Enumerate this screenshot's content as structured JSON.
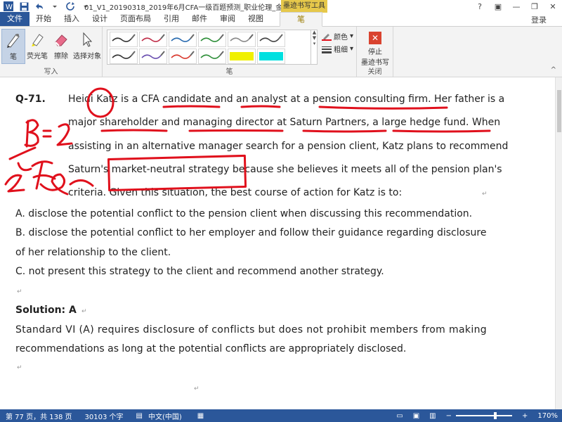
{
  "title_bar": {
    "doc_title": "01_V1_20190318_2019年6月CFA一级百题预测_职业伦理_金程...",
    "context_tab_title": "墨迹书写工具",
    "signin": "登录"
  },
  "tabs": [
    {
      "label": "文件"
    },
    {
      "label": "开始"
    },
    {
      "label": "插入"
    },
    {
      "label": "设计"
    },
    {
      "label": "页面布局"
    },
    {
      "label": "引用"
    },
    {
      "label": "邮件"
    },
    {
      "label": "审阅"
    },
    {
      "label": "视图"
    },
    {
      "label": "笔"
    }
  ],
  "ribbon": {
    "write_group": {
      "label": "写入",
      "tools": [
        {
          "label": "笔"
        },
        {
          "label": "荧光笔"
        },
        {
          "label": "擦除"
        },
        {
          "label": "选择对象"
        }
      ]
    },
    "pen_group": {
      "label": "笔",
      "color_label": "颜色",
      "weight_label": "粗细",
      "swatch_colors": [
        "#333333",
        "#c0304a",
        "#2b6cb0",
        "#2f8f3a",
        "#8a8a8a",
        "#444444",
        "#333333",
        "#6a4fb0",
        "#d93a2f",
        "#2f8f3a",
        "#f0f000",
        "#00e0e0"
      ]
    },
    "close_group": {
      "label": "关闭",
      "stop_label_1": "停止",
      "stop_label_2": "墨迹书写"
    }
  },
  "document": {
    "question_label": "Q-71.",
    "question_lines": [
      "Heidi Katz is a CFA candidate and an analyst at a pension consulting firm. Her father is a",
      "major shareholder and managing director at Saturn Partners, a large hedge fund. When",
      "assisting in an alternative manager search for a pension client, Katz plans to recommend",
      "Saturn's market-neutral strategy because she believes it meets all of the pension plan's",
      "criteria. Given this situation, the best course of action for Katz is to:"
    ],
    "option_a": "A.     disclose the potential conflict to the pension client when discussing this recommendation.",
    "option_b_1": "B.     disclose the potential conflict to her employer and follow their guidance regarding disclosure",
    "option_b_2": "of her relationship to the client.",
    "option_c": "C.     not present this strategy to the client and recommend another strategy.",
    "solution_label": "Solution: A",
    "solution_line_1": "Standard VI (A) requires disclosure of conflicts but does not prohibit members from making",
    "solution_line_2": "recommendations as long at the potential conflicts are appropriately disclosed."
  },
  "status_bar": {
    "page": "第 77 页，共 138 页",
    "words": "30103 个字",
    "lang": "中文(中国)",
    "zoom": "170%",
    "zoom_out": "−",
    "zoom_in": "+"
  },
  "ink_color": "#e0101c"
}
